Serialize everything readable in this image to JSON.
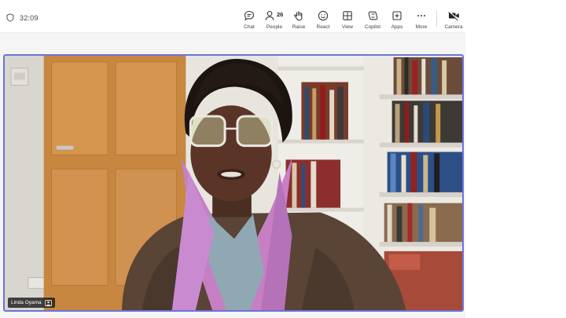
{
  "header": {
    "timer": "32:09"
  },
  "toolbar": {
    "items": [
      {
        "label": "Chat",
        "icon": "chat-icon"
      },
      {
        "label": "People",
        "icon": "people-icon",
        "count": "26"
      },
      {
        "label": "Raise",
        "icon": "raise-hand-icon"
      },
      {
        "label": "React",
        "icon": "react-icon"
      },
      {
        "label": "View",
        "icon": "view-icon"
      },
      {
        "label": "Copilot",
        "icon": "copilot-icon"
      },
      {
        "label": "Apps",
        "icon": "apps-icon"
      },
      {
        "label": "More",
        "icon": "more-icon"
      },
      {
        "label": "Camera",
        "icon": "camera-icon"
      }
    ]
  },
  "participant": {
    "name": "Linda Oyama"
  },
  "colors": {
    "active_speaker_border": "#6b73d8",
    "toolbar_background": "#ffffff",
    "name_tag_background": "#141414"
  }
}
